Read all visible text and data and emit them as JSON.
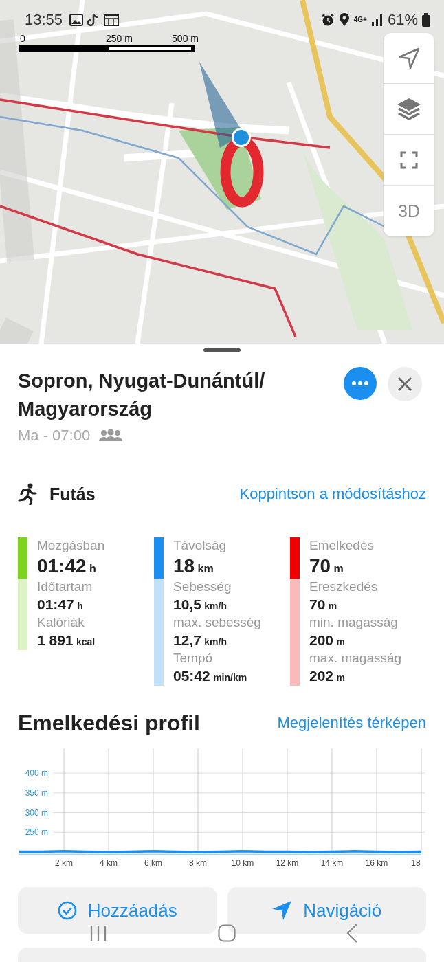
{
  "status_bar": {
    "time": "13:55",
    "network": "4G+",
    "battery": "61%"
  },
  "map": {
    "kind": "picture",
    "scale": [
      "0",
      "250 m",
      "500 m"
    ],
    "controls": [
      {
        "kind": "locate"
      },
      {
        "kind": "layers"
      },
      {
        "kind": "fullscreen"
      },
      {
        "kind": "text",
        "label": "3D"
      }
    ]
  },
  "place": {
    "title": "Sopron, Nyugat-Dunántúl/ Magyarország",
    "time": "Ma - 07:00"
  },
  "activity": {
    "kind": "run",
    "label": "Futás",
    "link": "Koppintson a módosításhoz"
  },
  "stats": [
    {
      "color": "#7ed321",
      "metrics": [
        {
          "label": "Mozgásban",
          "value": "01:42",
          "unit": "h"
        },
        {
          "label": "Időtartam",
          "value": "01:47",
          "unit": "h"
        },
        {
          "label": "Kalóriák",
          "value": "1 891",
          "unit": "kcal"
        }
      ]
    },
    {
      "color": "#1a8ff0",
      "metrics": [
        {
          "label": "Távolság",
          "value": "18",
          "unit": "km"
        },
        {
          "label": "Sebesség",
          "value": "10,5",
          "unit": "km/h"
        },
        {
          "label": "max. sebesség",
          "value": "12,7",
          "unit": "km/h"
        },
        {
          "label": "Tempó",
          "value": "05:42",
          "unit": "min/km"
        }
      ]
    },
    {
      "color": "#f00000",
      "metrics": [
        {
          "label": "Emelkedés",
          "value": "70",
          "unit": "m"
        },
        {
          "label": "Ereszkedés",
          "value": "70",
          "unit": "m"
        },
        {
          "label": "min. magasság",
          "value": "200",
          "unit": "m"
        },
        {
          "label": "max. magasság",
          "value": "202",
          "unit": "m"
        }
      ]
    }
  ],
  "profile": {
    "title": "Emelkedési profil",
    "link": "Megjelenítés térképen",
    "chart_data": {
      "type": "area",
      "x": [
        0,
        1,
        2,
        3,
        4,
        5,
        6,
        7,
        8,
        9,
        10,
        11,
        12,
        13,
        14,
        15,
        16,
        17,
        18
      ],
      "series": [
        {
          "color": "#1a8ff0",
          "values": [
            201,
            201,
            202,
            201,
            200,
            201,
            202,
            201,
            200,
            201,
            202,
            201,
            201,
            200,
            201,
            202,
            201,
            200,
            201
          ]
        }
      ],
      "grid": true,
      "xlim": [
        0,
        18
      ],
      "ylim": [
        193,
        463
      ],
      "xticks": [
        {
          "value": 2,
          "label": "2 km"
        },
        {
          "value": 4,
          "label": "4 km"
        },
        {
          "value": 6,
          "label": "6 km"
        },
        {
          "value": 8,
          "label": "8 km"
        },
        {
          "value": 10,
          "label": "10 km"
        },
        {
          "value": 12,
          "label": "12 km"
        },
        {
          "value": 14,
          "label": "14 km"
        },
        {
          "value": 16,
          "label": "16 km"
        },
        {
          "value": 18,
          "label": "18"
        }
      ],
      "yticks": [
        {
          "value": 250,
          "label": "250 m"
        },
        {
          "value": 300,
          "label": "300 m"
        },
        {
          "value": 350,
          "label": "350 m"
        },
        {
          "value": 400,
          "label": "400 m"
        }
      ]
    }
  },
  "buttons": [
    {
      "kind": "add",
      "label": "Hozzáadás"
    },
    {
      "kind": "navigate",
      "label": "Navigáció"
    }
  ],
  "nav_bar": [
    {
      "kind": "recents"
    },
    {
      "kind": "home"
    },
    {
      "kind": "back"
    }
  ]
}
